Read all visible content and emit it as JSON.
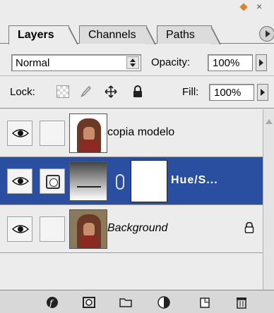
{
  "tabs": [
    {
      "label": "Layers",
      "active": true
    },
    {
      "label": "Channels",
      "active": false
    },
    {
      "label": "Paths",
      "active": false
    }
  ],
  "blend": {
    "mode": "Normal",
    "opacity_label": "Opacity:",
    "opacity_value": "100%"
  },
  "lock": {
    "label": "Lock:",
    "fill_label": "Fill:",
    "fill_value": "100%"
  },
  "layers": [
    {
      "name": "copia modelo",
      "type": "image-transparent",
      "visible": true,
      "selected": false
    },
    {
      "name": "Hue/S...",
      "type": "adjustment",
      "visible": true,
      "selected": true
    },
    {
      "name": "Background",
      "type": "image",
      "visible": true,
      "selected": false,
      "locked": true
    }
  ],
  "colors": {
    "selection": "#2a4fa0",
    "panel": "#ececec"
  }
}
